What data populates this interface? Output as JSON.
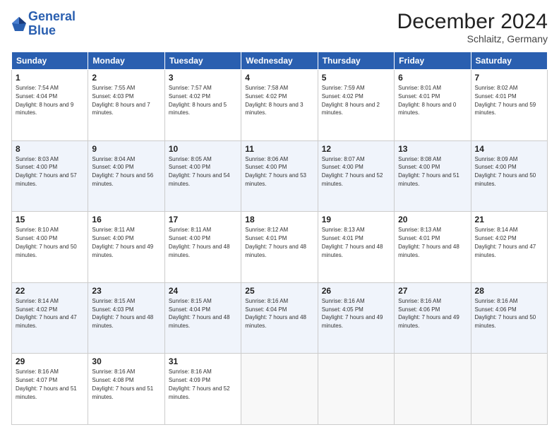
{
  "logo": {
    "line1": "General",
    "line2": "Blue"
  },
  "title": "December 2024",
  "location": "Schlaitz, Germany",
  "weekdays": [
    "Sunday",
    "Monday",
    "Tuesday",
    "Wednesday",
    "Thursday",
    "Friday",
    "Saturday"
  ],
  "weeks": [
    [
      {
        "day": "1",
        "sunrise": "Sunrise: 7:54 AM",
        "sunset": "Sunset: 4:04 PM",
        "daylight": "Daylight: 8 hours and 9 minutes."
      },
      {
        "day": "2",
        "sunrise": "Sunrise: 7:55 AM",
        "sunset": "Sunset: 4:03 PM",
        "daylight": "Daylight: 8 hours and 7 minutes."
      },
      {
        "day": "3",
        "sunrise": "Sunrise: 7:57 AM",
        "sunset": "Sunset: 4:02 PM",
        "daylight": "Daylight: 8 hours and 5 minutes."
      },
      {
        "day": "4",
        "sunrise": "Sunrise: 7:58 AM",
        "sunset": "Sunset: 4:02 PM",
        "daylight": "Daylight: 8 hours and 3 minutes."
      },
      {
        "day": "5",
        "sunrise": "Sunrise: 7:59 AM",
        "sunset": "Sunset: 4:02 PM",
        "daylight": "Daylight: 8 hours and 2 minutes."
      },
      {
        "day": "6",
        "sunrise": "Sunrise: 8:01 AM",
        "sunset": "Sunset: 4:01 PM",
        "daylight": "Daylight: 8 hours and 0 minutes."
      },
      {
        "day": "7",
        "sunrise": "Sunrise: 8:02 AM",
        "sunset": "Sunset: 4:01 PM",
        "daylight": "Daylight: 7 hours and 59 minutes."
      }
    ],
    [
      {
        "day": "8",
        "sunrise": "Sunrise: 8:03 AM",
        "sunset": "Sunset: 4:00 PM",
        "daylight": "Daylight: 7 hours and 57 minutes."
      },
      {
        "day": "9",
        "sunrise": "Sunrise: 8:04 AM",
        "sunset": "Sunset: 4:00 PM",
        "daylight": "Daylight: 7 hours and 56 minutes."
      },
      {
        "day": "10",
        "sunrise": "Sunrise: 8:05 AM",
        "sunset": "Sunset: 4:00 PM",
        "daylight": "Daylight: 7 hours and 54 minutes."
      },
      {
        "day": "11",
        "sunrise": "Sunrise: 8:06 AM",
        "sunset": "Sunset: 4:00 PM",
        "daylight": "Daylight: 7 hours and 53 minutes."
      },
      {
        "day": "12",
        "sunrise": "Sunrise: 8:07 AM",
        "sunset": "Sunset: 4:00 PM",
        "daylight": "Daylight: 7 hours and 52 minutes."
      },
      {
        "day": "13",
        "sunrise": "Sunrise: 8:08 AM",
        "sunset": "Sunset: 4:00 PM",
        "daylight": "Daylight: 7 hours and 51 minutes."
      },
      {
        "day": "14",
        "sunrise": "Sunrise: 8:09 AM",
        "sunset": "Sunset: 4:00 PM",
        "daylight": "Daylight: 7 hours and 50 minutes."
      }
    ],
    [
      {
        "day": "15",
        "sunrise": "Sunrise: 8:10 AM",
        "sunset": "Sunset: 4:00 PM",
        "daylight": "Daylight: 7 hours and 50 minutes."
      },
      {
        "day": "16",
        "sunrise": "Sunrise: 8:11 AM",
        "sunset": "Sunset: 4:00 PM",
        "daylight": "Daylight: 7 hours and 49 minutes."
      },
      {
        "day": "17",
        "sunrise": "Sunrise: 8:11 AM",
        "sunset": "Sunset: 4:00 PM",
        "daylight": "Daylight: 7 hours and 48 minutes."
      },
      {
        "day": "18",
        "sunrise": "Sunrise: 8:12 AM",
        "sunset": "Sunset: 4:01 PM",
        "daylight": "Daylight: 7 hours and 48 minutes."
      },
      {
        "day": "19",
        "sunrise": "Sunrise: 8:13 AM",
        "sunset": "Sunset: 4:01 PM",
        "daylight": "Daylight: 7 hours and 48 minutes."
      },
      {
        "day": "20",
        "sunrise": "Sunrise: 8:13 AM",
        "sunset": "Sunset: 4:01 PM",
        "daylight": "Daylight: 7 hours and 48 minutes."
      },
      {
        "day": "21",
        "sunrise": "Sunrise: 8:14 AM",
        "sunset": "Sunset: 4:02 PM",
        "daylight": "Daylight: 7 hours and 47 minutes."
      }
    ],
    [
      {
        "day": "22",
        "sunrise": "Sunrise: 8:14 AM",
        "sunset": "Sunset: 4:02 PM",
        "daylight": "Daylight: 7 hours and 47 minutes."
      },
      {
        "day": "23",
        "sunrise": "Sunrise: 8:15 AM",
        "sunset": "Sunset: 4:03 PM",
        "daylight": "Daylight: 7 hours and 48 minutes."
      },
      {
        "day": "24",
        "sunrise": "Sunrise: 8:15 AM",
        "sunset": "Sunset: 4:04 PM",
        "daylight": "Daylight: 7 hours and 48 minutes."
      },
      {
        "day": "25",
        "sunrise": "Sunrise: 8:16 AM",
        "sunset": "Sunset: 4:04 PM",
        "daylight": "Daylight: 7 hours and 48 minutes."
      },
      {
        "day": "26",
        "sunrise": "Sunrise: 8:16 AM",
        "sunset": "Sunset: 4:05 PM",
        "daylight": "Daylight: 7 hours and 49 minutes."
      },
      {
        "day": "27",
        "sunrise": "Sunrise: 8:16 AM",
        "sunset": "Sunset: 4:06 PM",
        "daylight": "Daylight: 7 hours and 49 minutes."
      },
      {
        "day": "28",
        "sunrise": "Sunrise: 8:16 AM",
        "sunset": "Sunset: 4:06 PM",
        "daylight": "Daylight: 7 hours and 50 minutes."
      }
    ],
    [
      {
        "day": "29",
        "sunrise": "Sunrise: 8:16 AM",
        "sunset": "Sunset: 4:07 PM",
        "daylight": "Daylight: 7 hours and 51 minutes."
      },
      {
        "day": "30",
        "sunrise": "Sunrise: 8:16 AM",
        "sunset": "Sunset: 4:08 PM",
        "daylight": "Daylight: 7 hours and 51 minutes."
      },
      {
        "day": "31",
        "sunrise": "Sunrise: 8:16 AM",
        "sunset": "Sunset: 4:09 PM",
        "daylight": "Daylight: 7 hours and 52 minutes."
      },
      null,
      null,
      null,
      null
    ]
  ]
}
